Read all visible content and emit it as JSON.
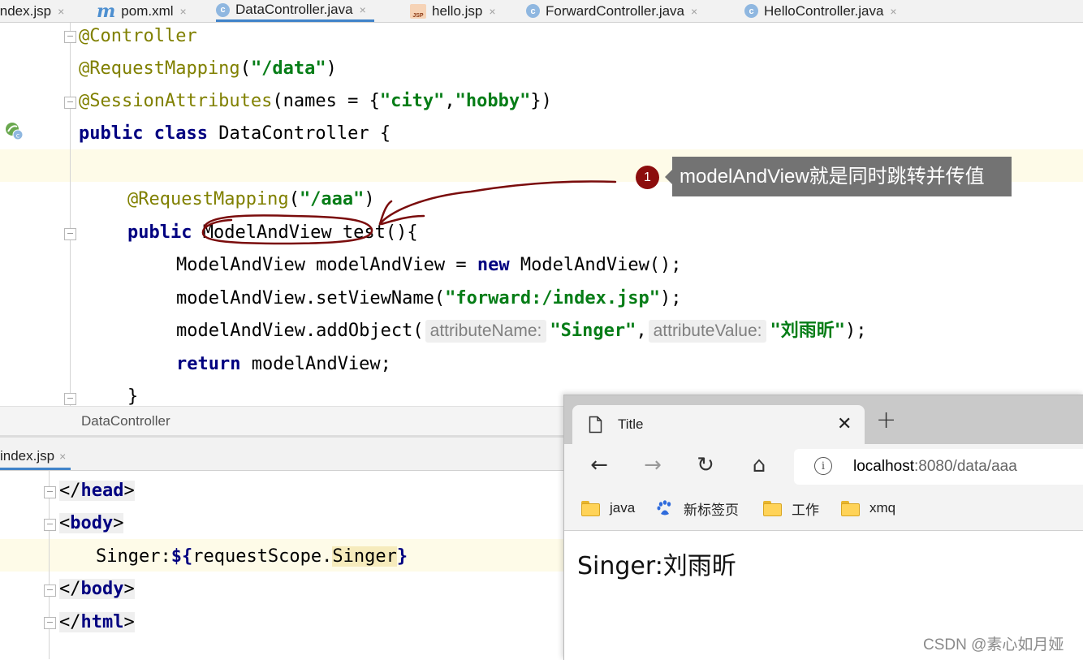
{
  "editor_tabs": [
    {
      "label": "index.jsp",
      "icon": "jsp-file-icon"
    },
    {
      "label": "pom.xml",
      "icon": "maven-icon"
    },
    {
      "label": "DataController.java",
      "icon": "java-class-icon",
      "active": true
    },
    {
      "label": "hello.jsp",
      "icon": "jsp-file-icon"
    },
    {
      "label": "ForwardController.java",
      "icon": "java-class-icon"
    },
    {
      "label": "HelloController.java",
      "icon": "java-class-icon"
    }
  ],
  "tab_close_glyph": "×",
  "code": {
    "l1_anno": "@Controller",
    "l2_anno": "@RequestMapping",
    "l2_open": "(",
    "l2_str": "\"/data\"",
    "l2_close": ")",
    "l3_anno": "@SessionAttributes",
    "l3_mid": "(names = {",
    "l3_s1": "\"city\"",
    "l3_comma": ",",
    "l3_s2": "\"hobby\"",
    "l3_end": "})",
    "l4_kw1": "public",
    "l4_kw2": "class",
    "l4_rest": " DataController {",
    "l6_anno": "@RequestMapping",
    "l6_open": "(",
    "l6_str": "\"/aaa\"",
    "l6_close": ")",
    "l7_kw": "public",
    "l7_rest": " ModelAndView test(){",
    "l8_a": "ModelAndView modelAndView = ",
    "l8_kw": "new",
    "l8_b": " ModelAndView();",
    "l9_a": "modelAndView.setViewName(",
    "l9_str": "\"forward:/index.jsp\"",
    "l9_b": ");",
    "l10_a": "modelAndView.addObject(",
    "l10_hint1": "attributeName:",
    "l10_str1": "\"Singer\"",
    "l10_comma": ",",
    "l10_hint2": "attributeValue:",
    "l10_str2": "\"刘雨昕\"",
    "l10_b": ");",
    "l11_kw": "return",
    "l11_rest": " modelAndView;",
    "l12": "}"
  },
  "callout": {
    "number": "1",
    "text": "modelAndView就是同时跳转并传值"
  },
  "breadcrumb": "DataController",
  "bottom_tab": {
    "label": "index.jsp"
  },
  "jsp": {
    "l1_open": "</",
    "l1_tag": "head",
    "l1_close": ">",
    "l2_open": "<",
    "l2_tag": "body",
    "l2_close": ">",
    "l3_text": "Singer:",
    "l3_el_open": "${",
    "l3_el_scope": "requestScope.",
    "l3_el_prop": "Singer",
    "l3_el_close": "}",
    "l4_open": "</",
    "l4_tag": "body",
    "l4_close": ">",
    "l5_open": "</",
    "l5_tag": "html",
    "l5_close": ">"
  },
  "browser": {
    "tab_title": "Title",
    "close_glyph": "✕",
    "new_tab_glyph": "+",
    "back": "←",
    "forward": "→",
    "reload": "↻",
    "home": "⌂",
    "info_glyph": "i",
    "url_host": "localhost",
    "url_rest": ":8080/data/aaa",
    "bookmarks": [
      {
        "label": "java",
        "icon": "folder-icon"
      },
      {
        "label": "新标签页",
        "icon": "baidu-paw-icon"
      },
      {
        "label": "工作",
        "icon": "folder-icon"
      },
      {
        "label": "xmq",
        "icon": "folder-icon"
      }
    ],
    "page_output": "Singer:刘雨昕"
  },
  "watermark": "CSDN @素心如月娅"
}
